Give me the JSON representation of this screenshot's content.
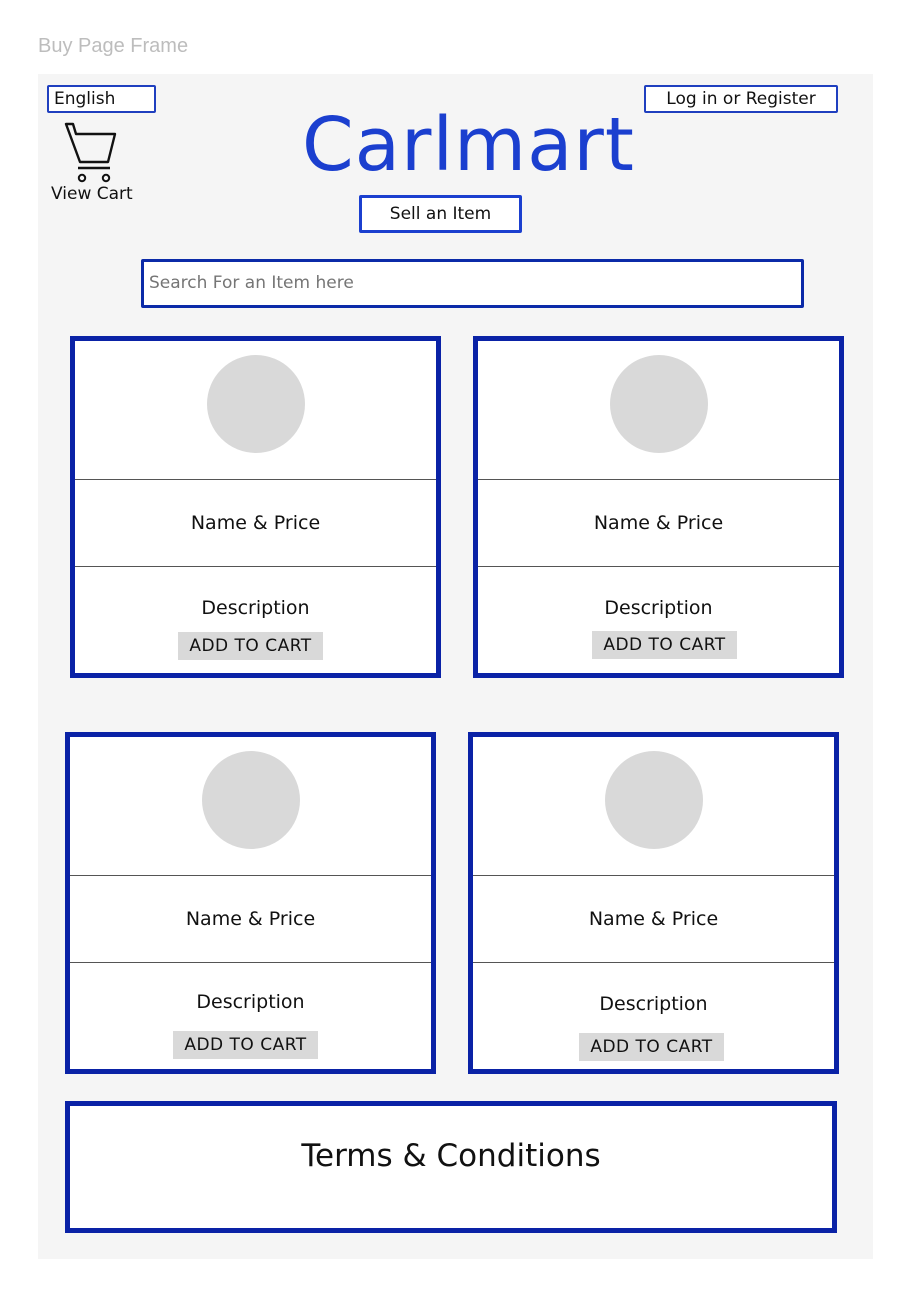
{
  "frame": {
    "label": "Buy Page Frame"
  },
  "header": {
    "language": "English",
    "login": "Log in or Register",
    "cart_label": "View Cart",
    "brand": "Carlmart",
    "sell_button": "Sell an Item"
  },
  "search": {
    "placeholder": "Search For an Item here"
  },
  "cards": [
    {
      "name_price": "Name & Price",
      "description": "Description",
      "add_to_cart": "ADD TO CART"
    },
    {
      "name_price": "Name & Price",
      "description": "Description",
      "add_to_cart": "ADD TO CART"
    },
    {
      "name_price": "Name & Price",
      "description": "Description",
      "add_to_cart": "ADD TO CART"
    },
    {
      "name_price": "Name & Price",
      "description": "Description",
      "add_to_cart": "ADD TO CART"
    }
  ],
  "footer": {
    "terms": "Terms & Conditions"
  },
  "colors": {
    "accent_blue": "#1b3fcf",
    "card_border": "#0a22a6",
    "frame_bg": "#f5f5f5",
    "placeholder_gray": "#d9d9d9"
  },
  "icons": {
    "cart": "shopping-cart-icon"
  }
}
